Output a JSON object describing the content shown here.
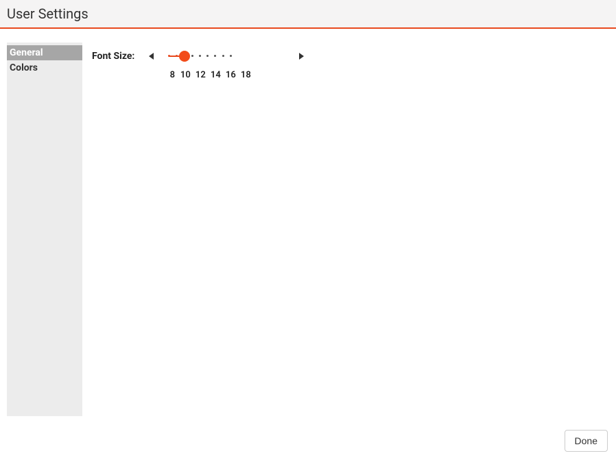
{
  "header": {
    "title": "User Settings"
  },
  "sidebar": {
    "items": [
      {
        "label": "General",
        "active": true
      },
      {
        "label": "Colors",
        "active": false
      }
    ]
  },
  "content": {
    "fontSize": {
      "label": "Font Size:",
      "ticks": [
        8,
        10,
        12,
        14,
        16,
        18
      ],
      "value": 12,
      "valueIndex": 2,
      "extraDots": 3
    }
  },
  "footer": {
    "done": "Done"
  },
  "colors": {
    "accent": "#e8491e"
  }
}
